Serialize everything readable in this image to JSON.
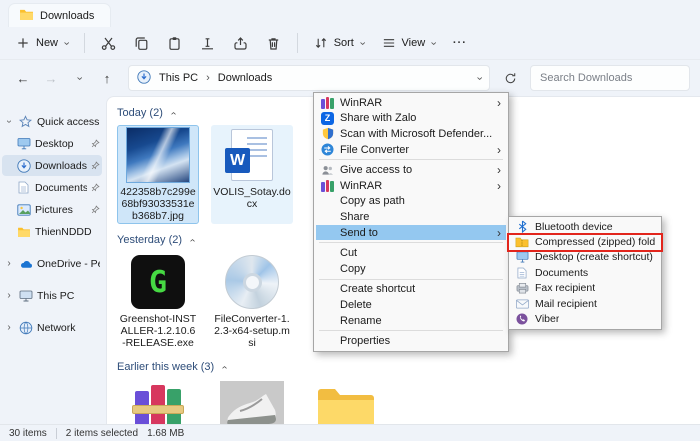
{
  "window": {
    "tab_title": "Downloads"
  },
  "toolbar": {
    "new_label": "New",
    "sort_label": "Sort",
    "view_label": "View"
  },
  "addressbar": {
    "breadcrumb": [
      {
        "label": "This PC"
      },
      {
        "label": "Downloads"
      }
    ],
    "search_placeholder": "Search Downloads"
  },
  "sidebar": {
    "quick_access_label": "Quick access",
    "pinned": [
      {
        "label": "Desktop"
      },
      {
        "label": "Downloads"
      },
      {
        "label": "Documents"
      },
      {
        "label": "Pictures"
      },
      {
        "label": "ThienNDDD"
      }
    ],
    "roots": [
      {
        "label": "OneDrive - Personal"
      },
      {
        "label": "This PC"
      },
      {
        "label": "Network"
      }
    ]
  },
  "content": {
    "groups": [
      {
        "label": "Today (2)"
      },
      {
        "label": "Yesterday (2)"
      },
      {
        "label": "Earlier this week (3)"
      }
    ],
    "files": [
      {
        "name": "422358b7c299e68bf93033531eb368b7.jpg"
      },
      {
        "name": "VOLIS_Sotay.docx"
      },
      {
        "name": "Greenshot-INSTALLER-1.2.10.6-RELEASE.exe"
      },
      {
        "name": "FileConverter-1.2.3-x64-setup.msi"
      }
    ]
  },
  "context_menu": {
    "items": [
      {
        "label": "WinRAR"
      },
      {
        "label": "Share with Zalo"
      },
      {
        "label": "Scan with Microsoft Defender..."
      },
      {
        "label": "File Converter"
      },
      {
        "label": "Give access to"
      },
      {
        "label": "WinRAR"
      },
      {
        "label": "Copy as path"
      },
      {
        "label": "Share"
      },
      {
        "label": "Send to"
      },
      {
        "label": "Cut"
      },
      {
        "label": "Copy"
      },
      {
        "label": "Create shortcut"
      },
      {
        "label": "Delete"
      },
      {
        "label": "Rename"
      },
      {
        "label": "Properties"
      }
    ]
  },
  "send_to_menu": {
    "items": [
      {
        "label": "Bluetooth device"
      },
      {
        "label": "Compressed (zipped) folder"
      },
      {
        "label": "Desktop (create shortcut)"
      },
      {
        "label": "Documents"
      },
      {
        "label": "Fax recipient"
      },
      {
        "label": "Mail recipient"
      },
      {
        "label": "Viber"
      }
    ]
  },
  "statusbar": {
    "item_count": "30 items",
    "selection": "2 items selected",
    "selection_size": "1.68 MB"
  },
  "icons": {
    "chevron_right": "›",
    "back_arrow": "←",
    "forward_arrow": "→",
    "up_arrow": "↑",
    "more_dots": "···",
    "word_letter": "W",
    "greenshot_letter": "G",
    "zalo_letter": "Z"
  },
  "colors": {
    "menu_highlight": "#94c8f0",
    "annotation_red": "#e2251c",
    "selection_blue": "#cfe6f9",
    "accent": "#0067c0"
  }
}
